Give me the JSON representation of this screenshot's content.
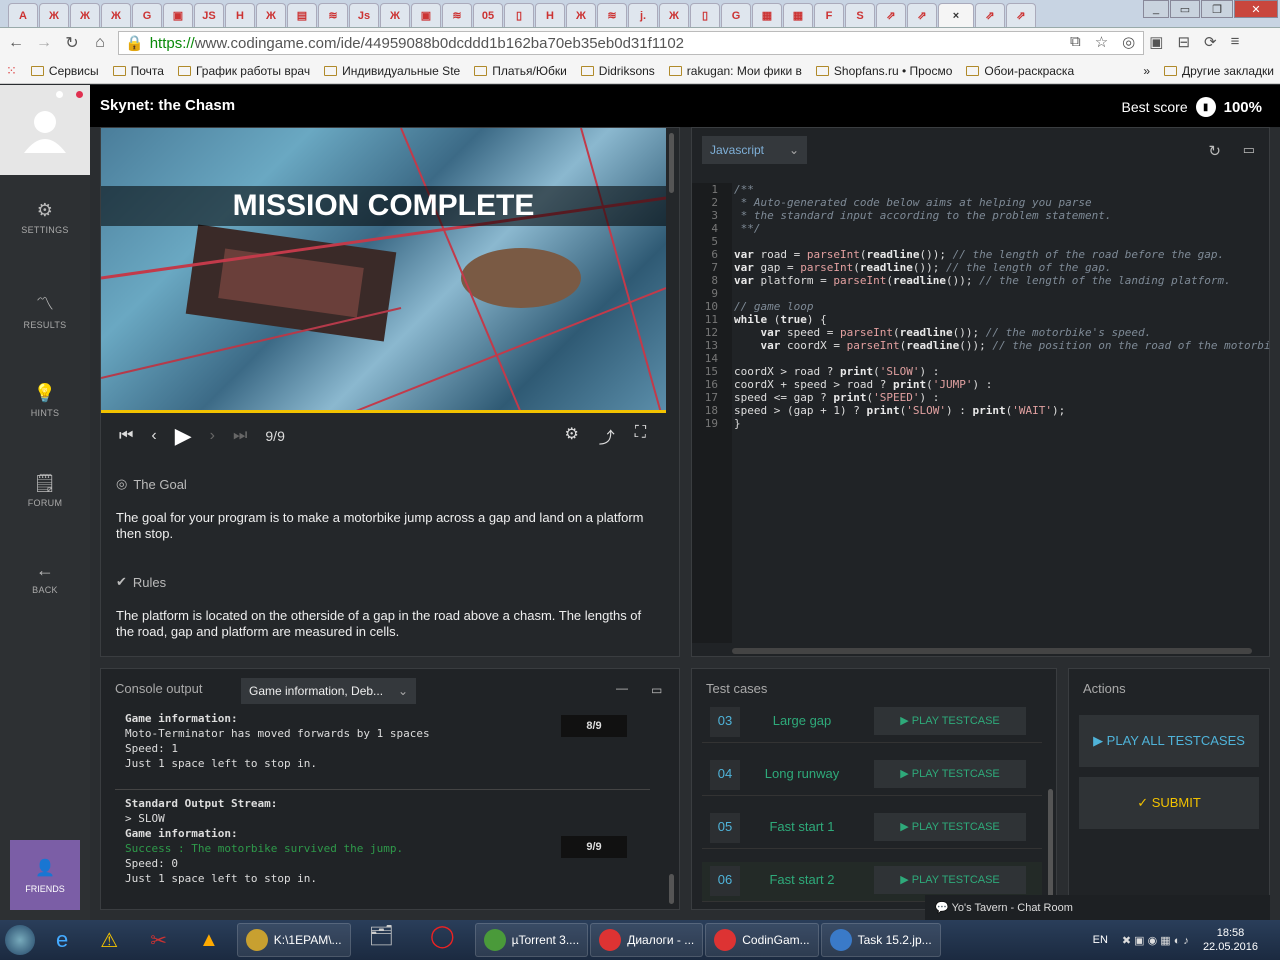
{
  "browser": {
    "tab_glyphs": [
      "A",
      "Ж",
      "Ж",
      "Ж",
      "G",
      "▣",
      "JS",
      "H",
      "Ж",
      "▤",
      "≋",
      "Js",
      "Ж",
      "▣",
      "≋",
      "05",
      "▯",
      "H",
      "Ж",
      "≋",
      "j.",
      "Ж",
      "▯",
      "G",
      "▦",
      "▦",
      "F",
      "S",
      "⇗",
      "⇗",
      "×",
      "⇗",
      "⇗"
    ],
    "url_scheme": "https://",
    "url_rest": "www.codingame.com/ide/44959088b0dcddd1b162ba70eb35eb0d31f1102",
    "bookmarks": [
      "Сервисы",
      "Почта",
      "График работы врач",
      "Индивидуальные Ste",
      "Платья/Юбки",
      "Didriksons",
      "rakugan: Мои фики в",
      "Shopfans.ru • Просмо",
      "Обои-раскраска"
    ],
    "bookmarks_more": "»",
    "bookmarks_other": "Другие закладки"
  },
  "sidebar": {
    "items": [
      {
        "label": "SETTINGS",
        "icon": "gear-icon",
        "glyph": "⚙"
      },
      {
        "label": "RESULTS",
        "icon": "chart-icon",
        "glyph": "〽"
      },
      {
        "label": "HINTS",
        "icon": "bulb-icon",
        "glyph": "💡"
      },
      {
        "label": "FORUM",
        "icon": "forum-icon",
        "glyph": "🗒"
      },
      {
        "label": "BACK",
        "icon": "back-arrow-icon",
        "glyph": "←"
      }
    ],
    "friends_label": "FRIENDS"
  },
  "header": {
    "title": "Skynet: the Chasm",
    "best_label": "Best score",
    "best_value": "100%"
  },
  "viewer": {
    "banner": "MISSION COMPLETE",
    "frame": "9/9",
    "goal_title": "The Goal",
    "goal_text": "The goal for your program is to make a motorbike jump across a gap and land on a platform then stop.",
    "rules_title": "Rules",
    "rules_text": "The platform is located on the otherside of a gap in the road above a chasm. The lengths of the road, gap and platform are measured in cells."
  },
  "editor": {
    "language": "Javascript",
    "line_numbers": [
      "1",
      "2",
      "3",
      "4",
      "5",
      "6",
      "7",
      "8",
      "9",
      "10",
      "11",
      "12",
      "13",
      "14",
      "15",
      "16",
      "17",
      "18",
      "19"
    ]
  },
  "console": {
    "title": "Console output",
    "dropdown": "Game information, Deb...",
    "block1": {
      "heading": "Game information:",
      "line1": "Moto-Terminator has moved forwards by 1 spaces",
      "line2": "Speed: 1",
      "line3": "Just 1 space left to stop in.",
      "badge": "8/9"
    },
    "block2": {
      "heading": "Standard Output Stream:",
      "out": "> SLOW",
      "heading2": "Game information:",
      "success": "Success : The motorbike survived the jump.",
      "line2": "Speed: 0",
      "line3": "Just 1 space left to stop in.",
      "badge": "9/9"
    }
  },
  "tests": {
    "title": "Test cases",
    "button_label": "▶  PLAY TESTCASE",
    "rows": [
      {
        "num": "03",
        "name": "Large gap"
      },
      {
        "num": "04",
        "name": "Long runway"
      },
      {
        "num": "05",
        "name": "Fast start 1"
      },
      {
        "num": "06",
        "name": "Fast start 2"
      }
    ]
  },
  "actions": {
    "title": "Actions",
    "play_all": "▶  PLAY ALL TESTCASES",
    "submit": "✓  SUBMIT"
  },
  "chat": {
    "label": "Yo's Tavern - Chat Room"
  },
  "taskbar": {
    "items": [
      "K:\\1EPAM\\...",
      "µTorrent 3....",
      "Диалоги - ...",
      "CodinGam...",
      "Task 15.2.jp..."
    ],
    "lang": "EN",
    "time": "18:58",
    "date": "22.05.2016"
  },
  "colors": {
    "accent": "#2eaa7a",
    "link": "#4fb3d9",
    "friends": "#7b5ea6",
    "progress": "#f2c200"
  }
}
